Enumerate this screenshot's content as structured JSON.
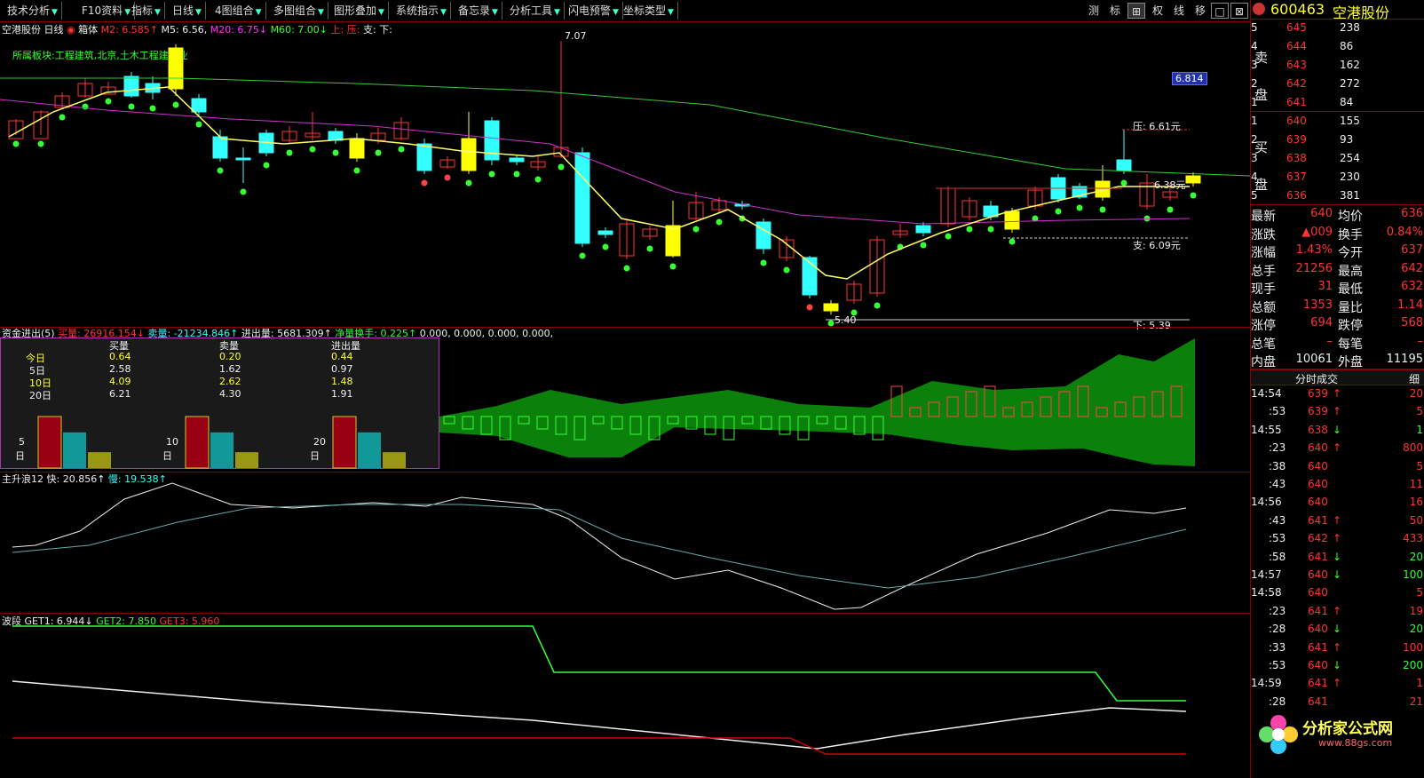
{
  "toolbar": {
    "items": [
      "技术分析",
      "F10资料",
      "指标",
      "日线",
      "4图组合",
      "多图组合",
      "图形叠加",
      "系统指示",
      "备忘录",
      "分析工具",
      "闪电预警",
      "坐标类型"
    ],
    "right_buttons": [
      "测",
      "标",
      "⊞",
      "权",
      "线",
      "移",
      "□",
      "⊠"
    ]
  },
  "quote": {
    "code": "600463",
    "name": "空港股份",
    "asks": [
      {
        "n": "5",
        "price": "645",
        "vol": "238"
      },
      {
        "n": "4",
        "price": "644",
        "vol": "86"
      },
      {
        "n": "3",
        "price": "643",
        "vol": "162"
      },
      {
        "n": "2",
        "price": "642",
        "vol": "272"
      },
      {
        "n": "1",
        "price": "641",
        "vol": "84"
      }
    ],
    "bids": [
      {
        "n": "1",
        "price": "640",
        "vol": "155"
      },
      {
        "n": "2",
        "price": "639",
        "vol": "93"
      },
      {
        "n": "3",
        "price": "638",
        "vol": "254"
      },
      {
        "n": "4",
        "price": "637",
        "vol": "230"
      },
      {
        "n": "5",
        "price": "636",
        "vol": "381"
      }
    ],
    "sell_label": "卖盘",
    "buy_label": "买盘",
    "stats": [
      {
        "l1": "最新",
        "v1": "640",
        "l2": "均价",
        "v2": "636"
      },
      {
        "l1": "涨跌",
        "v1": "▲009",
        "l2": "换手",
        "v2": "0.84%"
      },
      {
        "l1": "涨幅",
        "v1": "1.43%",
        "l2": "今开",
        "v2": "637"
      },
      {
        "l1": "总手",
        "v1": "21256",
        "l2": "最高",
        "v2": "642"
      },
      {
        "l1": "现手",
        "v1": "31",
        "l2": "最低",
        "v2": "632"
      },
      {
        "l1": "总额",
        "v1": "1353",
        "l2": "量比",
        "v2": "1.14"
      },
      {
        "l1": "涨停",
        "v1": "694",
        "l2": "跌停",
        "v2": "568"
      },
      {
        "l1": "总笔",
        "v1": "–",
        "l2": "每笔",
        "v2": "–"
      },
      {
        "l1": "内盘",
        "v1": "10061",
        "l2": "外盘",
        "v2": "11195"
      }
    ],
    "ticks_header": "分时成交",
    "ticks_detail": "细",
    "ticks": [
      {
        "t": "14:54",
        "p": "639",
        "d": "↑",
        "v": "20"
      },
      {
        "t": ":53",
        "p": "639",
        "d": "↑",
        "v": "5"
      },
      {
        "t": "14:55",
        "p": "638",
        "d": "↓",
        "v": "1"
      },
      {
        "t": ":23",
        "p": "640",
        "d": "↑",
        "v": "800"
      },
      {
        "t": ":38",
        "p": "640",
        "d": "",
        "v": "5"
      },
      {
        "t": ":43",
        "p": "640",
        "d": "",
        "v": "11"
      },
      {
        "t": "14:56",
        "p": "640",
        "d": "",
        "v": "16"
      },
      {
        "t": ":43",
        "p": "641",
        "d": "↑",
        "v": "50"
      },
      {
        "t": ":53",
        "p": "642",
        "d": "↑",
        "v": "433"
      },
      {
        "t": ":58",
        "p": "641",
        "d": "↓",
        "v": "20"
      },
      {
        "t": "14:57",
        "p": "640",
        "d": "↓",
        "v": "100"
      },
      {
        "t": "14:58",
        "p": "640",
        "d": "",
        "v": "5"
      },
      {
        "t": ":23",
        "p": "641",
        "d": "↑",
        "v": "19"
      },
      {
        "t": ":28",
        "p": "640",
        "d": "↓",
        "v": "20"
      },
      {
        "t": ":33",
        "p": "641",
        "d": "↑",
        "v": "100"
      },
      {
        "t": ":53",
        "p": "640",
        "d": "↓",
        "v": "200"
      },
      {
        "t": "14:59",
        "p": "641",
        "d": "↑",
        "v": "1"
      },
      {
        "t": ":28",
        "p": "641",
        "d": "",
        "v": "21"
      }
    ]
  },
  "main": {
    "title": "空港股份 日线",
    "box": "箱体",
    "m2": "M2: 6.585↑",
    "m5": "M5: 6.56,",
    "m20": "M20: 6.75↓",
    "m60": "M60: 7.00↓",
    "up": "上:",
    "pres": "压:",
    "sup": "支:",
    "dn": "下:",
    "sector": "所属板块:工程建筑,北京,土木工程建筑业",
    "price_tag": "6.814",
    "hi": "7.07",
    "lo": "5.40",
    "pres_val": "压: 6.61元",
    "sup_val": "支: 6.09元",
    "mid_val": "6.38元",
    "low_right": "下: 5.39"
  },
  "fund": {
    "title": "资金进出(5)",
    "buy": "买量: 26916.154↓",
    "sell": "卖量: -21234.846↑",
    "net": "进出量: 5681.309↑",
    "turn": "净量换手: 0.225↑",
    "rest": "0.000, 0.000, 0.000, 0.000,",
    "headers": [
      "买量",
      "卖量",
      "进出量"
    ],
    "rows": [
      {
        "k": "今日",
        "b": "0.64",
        "s": "0.20",
        "n": "0.44"
      },
      {
        "k": "5日",
        "b": "2.58",
        "s": "1.62",
        "n": "0.97"
      },
      {
        "k": "10日",
        "b": "4.09",
        "s": "2.62",
        "n": "1.48"
      },
      {
        "k": "20日",
        "b": "6.21",
        "s": "4.30",
        "n": "1.91"
      }
    ],
    "bars": [
      {
        "label": "5\n日",
        "v": [
          6.21,
          4.3,
          1.91
        ]
      },
      {
        "label": "10\n日",
        "v": [
          6.21,
          4.3,
          1.91
        ]
      },
      {
        "label": "20\n日",
        "v": [
          6.21,
          4.3,
          1.91
        ]
      }
    ]
  },
  "wave": {
    "title": "主升浪12",
    "fast": "快: 20.856↑",
    "slow": "慢: 19.538↑"
  },
  "band": {
    "title": "波段",
    "g1": "GET1: 6.944↓",
    "g2": "GET2: 7.850",
    "g3": "GET3: 5.960"
  },
  "brand": {
    "name": "分析家公式网",
    "url": "www.88gs.com"
  },
  "colors": {
    "up": "#ff3333",
    "down": "#33ffff",
    "yellow": "#ffff00",
    "green": "#33ff33"
  }
}
